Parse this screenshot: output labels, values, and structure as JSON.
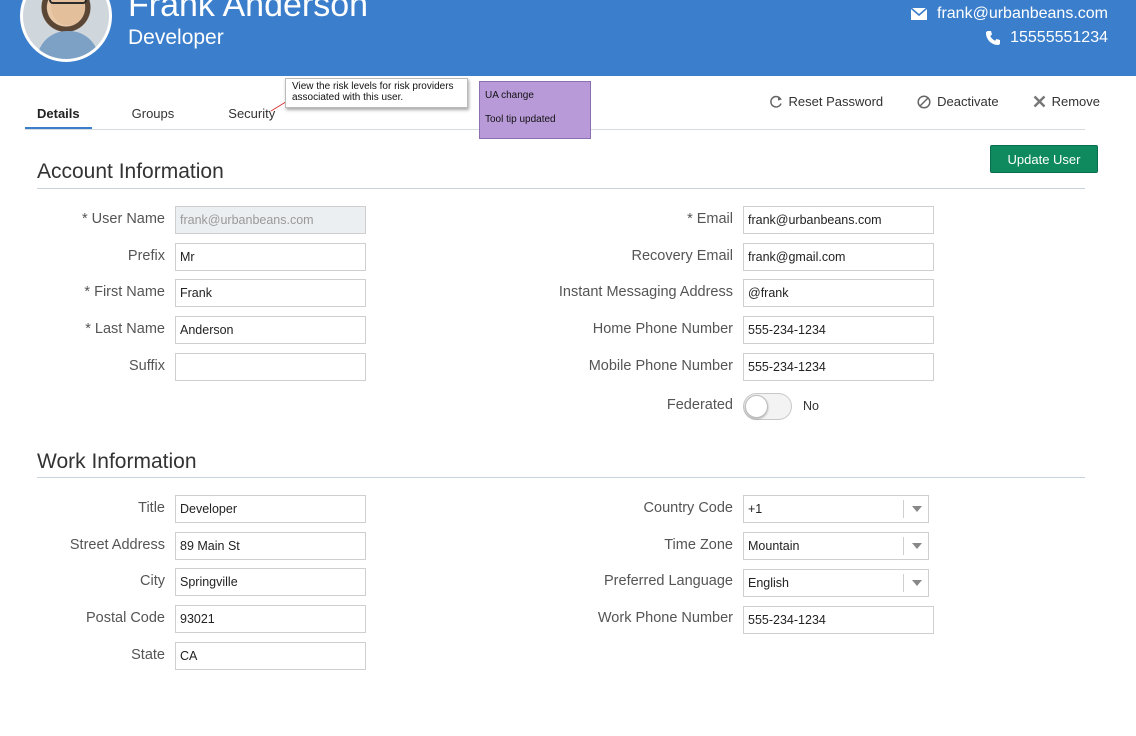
{
  "header": {
    "name": "Frank Anderson",
    "role": "Developer",
    "email": "frank@urbanbeans.com",
    "phone": "15555551234"
  },
  "tabs": [
    {
      "label": "Details",
      "active": true
    },
    {
      "label": "Groups",
      "active": false
    },
    {
      "label": "Security",
      "active": false
    }
  ],
  "callout": {
    "text": "View the risk levels for risk providers associated with this user."
  },
  "sticky_note": {
    "line1": "UA change",
    "line2": "Tool tip updated"
  },
  "actions": {
    "reset_password": "Reset Password",
    "deactivate": "Deactivate",
    "remove": "Remove"
  },
  "update_button": "Update User",
  "account_info": {
    "title": "Account Information",
    "user_name": {
      "label": "* User Name",
      "value": "frank@urbanbeans.com"
    },
    "prefix": {
      "label": "Prefix",
      "value": "Mr"
    },
    "first_name": {
      "label": "* First Name",
      "value": "Frank"
    },
    "last_name": {
      "label": "* Last Name",
      "value": "Anderson"
    },
    "suffix": {
      "label": "Suffix",
      "value": ""
    },
    "email": {
      "label": "* Email",
      "value": "frank@urbanbeans.com"
    },
    "recovery_email": {
      "label": "Recovery Email",
      "value": "frank@gmail.com"
    },
    "im_address": {
      "label": "Instant Messaging Address",
      "value": "@frank"
    },
    "home_phone": {
      "label": "Home Phone Number",
      "value": " 555-234-1234"
    },
    "mobile_phone": {
      "label": "Mobile Phone Number",
      "value": " 555-234-1234"
    },
    "federated": {
      "label": "Federated",
      "state": "No"
    }
  },
  "work_info": {
    "title": "Work Information",
    "title_field": {
      "label": "Title",
      "value": "Developer"
    },
    "street": {
      "label": "Street Address",
      "value": "89 Main St"
    },
    "city": {
      "label": "City",
      "value": "Springville"
    },
    "postal": {
      "label": "Postal Code",
      "value": "93021"
    },
    "state": {
      "label": "State",
      "value": "CA"
    },
    "country_code": {
      "label": "Country Code",
      "value": "+1"
    },
    "time_zone": {
      "label": "Time Zone",
      "value": "Mountain"
    },
    "language": {
      "label": "Preferred Language",
      "value": "English"
    },
    "work_phone": {
      "label": "Work Phone Number",
      "value": "555-234-1234"
    }
  },
  "colors": {
    "header_bg": "#3b7ecb",
    "update_button_bg": "#0f8a5f",
    "sticky_bg": "#b99ad9"
  },
  "icons": {
    "email": "envelope-icon",
    "phone": "phone-icon",
    "reset": "refresh-icon",
    "deactivate": "block-icon",
    "remove": "x-icon"
  }
}
